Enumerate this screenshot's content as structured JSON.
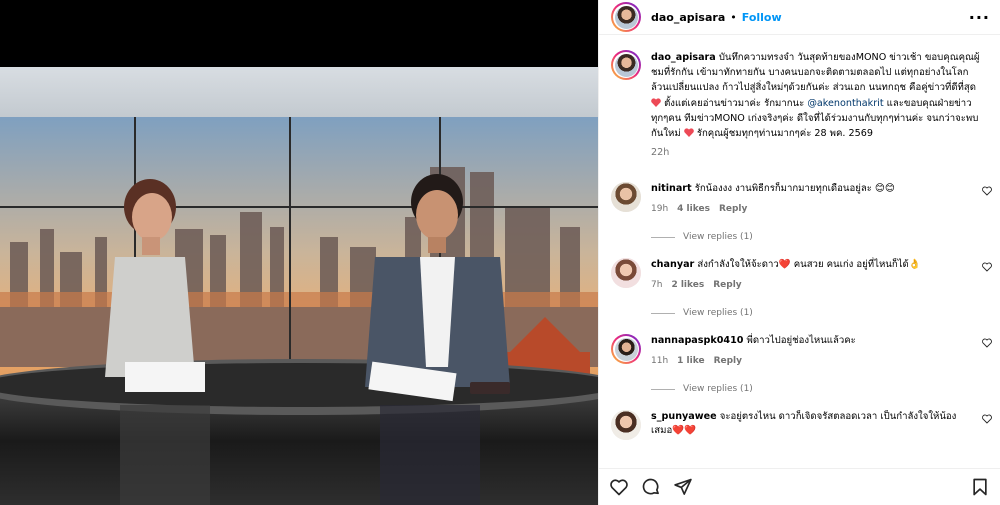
{
  "post": {
    "username": "dao_apisara",
    "follow_label": "Follow",
    "dot": "•",
    "more_label": "···",
    "caption_user": "dao_apisara",
    "caption_1": "บันทึกความทรงจำ วันสุดท้ายของMONO ข่าวเช้า ขอบคุณคุณผู้ชมที่รักกัน เข้ามาทักทายกัน บางคนบอกจะติดตามตลอดไป แต่ทุกอย่างในโลกล้วนเปลี่ยนแปลง ก้าวไปสู่สิ่งใหม่ๆด้วยกันค่ะ ส่วนเอก นนทกฤช คือคู่ข่าวที่ดีที่สุด",
    "caption_2": " ตั้งแต่เคยอ่านข่าวมาค่ะ รักมากนะ ",
    "caption_mention": "@akenonthakrit",
    "caption_3": " และขอบคุณฝ่ายข่าวทุกๆคน ทีมข่าวMONO เก่งจริงๆค่ะ ดีใจที่ได้ร่วมงานกับทุกๆท่านค่ะ จนกว่าจะพบกันใหม่",
    "caption_4": " รักคุณผู้ชมทุกๆท่านมากๆค่ะ 28 พค. 2569",
    "caption_time": "22h",
    "heart_color": "#ed4956"
  },
  "comments": [
    {
      "user": "nitinart",
      "text": "รักน้องงง งานพิธีกรก็มากมายทุกเดือนอยู่ละ 😊😊",
      "time": "19h",
      "likes": "4 likes",
      "reply": "Reply",
      "view_replies": "View replies (1)"
    },
    {
      "user": "chanyar",
      "text": "ส่งกำลังใจให้จ้ะดาว❤️ คนสวย คนเก่ง อยู่ที่ไหนก็ได้👌",
      "time": "7h",
      "likes": "2 likes",
      "reply": "Reply",
      "view_replies": "View replies (1)"
    },
    {
      "user": "nannapaspk0410",
      "text": "พี่ดาวไปอยู่ช่องไหนแล้วคะ",
      "time": "11h",
      "likes": "1 like",
      "reply": "Reply",
      "view_replies": "View replies (1)"
    },
    {
      "user": "s_punyawee",
      "text": "จะอยู่ตรงไหน ดาวก็เจิดจรัสตลอดเวลา เป็นกำลังใจให้น้องเสมอ❤️❤️",
      "time": "",
      "likes": "",
      "reply": "",
      "view_replies": ""
    }
  ],
  "icons": {
    "like": "heart-icon",
    "comment": "comment-icon",
    "share": "share-icon",
    "save": "bookmark-icon"
  }
}
